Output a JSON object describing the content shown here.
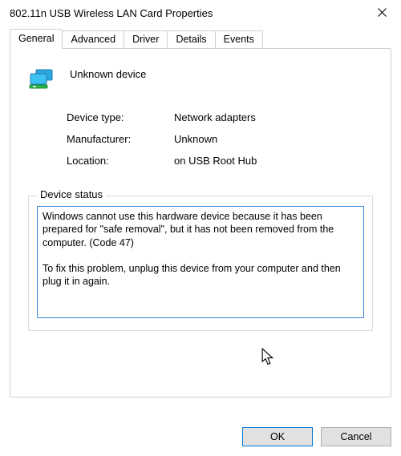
{
  "window": {
    "title": "802.11n USB Wireless LAN Card Properties"
  },
  "tabs": {
    "general": "General",
    "advanced": "Advanced",
    "driver": "Driver",
    "details": "Details",
    "events": "Events"
  },
  "device": {
    "name": "Unknown device"
  },
  "rows": {
    "type_label": "Device type:",
    "type_value": "Network adapters",
    "mfr_label": "Manufacturer:",
    "mfr_value": "Unknown",
    "loc_label": "Location:",
    "loc_value": "on USB Root Hub"
  },
  "status": {
    "legend": "Device status",
    "text": "Windows cannot use this hardware device because it has been prepared for \"safe removal\", but it has not been removed from the computer. (Code 47)\n\nTo fix this problem, unplug this device from your computer and then plug it in again."
  },
  "buttons": {
    "ok": "OK",
    "cancel": "Cancel"
  }
}
